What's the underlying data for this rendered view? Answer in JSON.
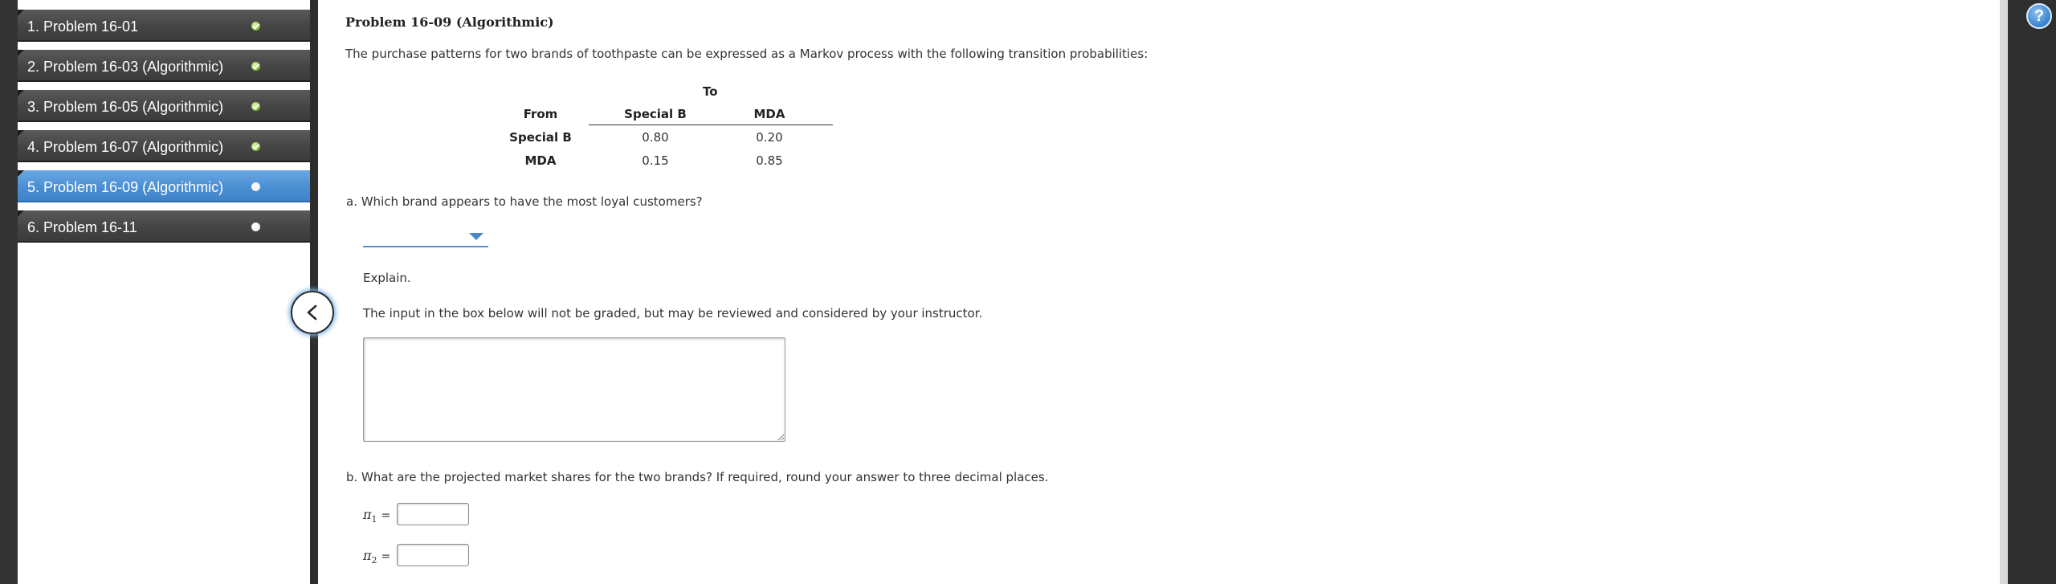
{
  "sidebar": {
    "items": [
      {
        "label": "1. Problem 16-01",
        "status": "complete"
      },
      {
        "label": "2. Problem 16-03 (Algorithmic)",
        "status": "complete"
      },
      {
        "label": "3. Problem 16-05 (Algorithmic)",
        "status": "complete"
      },
      {
        "label": "4. Problem 16-07 (Algorithmic)",
        "status": "complete"
      },
      {
        "label": "5. Problem 16-09 (Algorithmic)",
        "status": "active"
      },
      {
        "label": "6. Problem 16-11",
        "status": "incomplete"
      }
    ]
  },
  "help": {
    "label": "?"
  },
  "problem": {
    "title": "Problem 16-09 (Algorithmic)",
    "intro": "The purchase patterns for two brands of toothpaste can be expressed as a Markov process with the following transition probabilities:",
    "table": {
      "to_header": "To",
      "from_header": "From",
      "columns": [
        "Special B",
        "MDA"
      ],
      "rows": [
        {
          "label": "Special B",
          "values": [
            "0.80",
            "0.20"
          ]
        },
        {
          "label": "MDA",
          "values": [
            "0.15",
            "0.85"
          ]
        }
      ]
    },
    "part_a": {
      "question": "a. Which brand appears to have the most loyal customers?",
      "dropdown_value": "",
      "explain_label": "Explain.",
      "explain_note": "The input in the box below will not be graded, but may be reviewed and considered by your instructor.",
      "explain_value": ""
    },
    "part_b": {
      "question": "b. What are the projected market shares for the two brands? If required, round your answer to three decimal places.",
      "pi1_symbol": "π",
      "pi1_sub": "1",
      "pi2_symbol": "π",
      "pi2_sub": "2",
      "equals": "=",
      "pi1_value": "",
      "pi2_value": ""
    }
  },
  "colors": {
    "active_nav": "#4b8fd3",
    "nav_bg": "#454545",
    "complete_dot": "#8cc63f",
    "accent": "#4a86c8"
  }
}
